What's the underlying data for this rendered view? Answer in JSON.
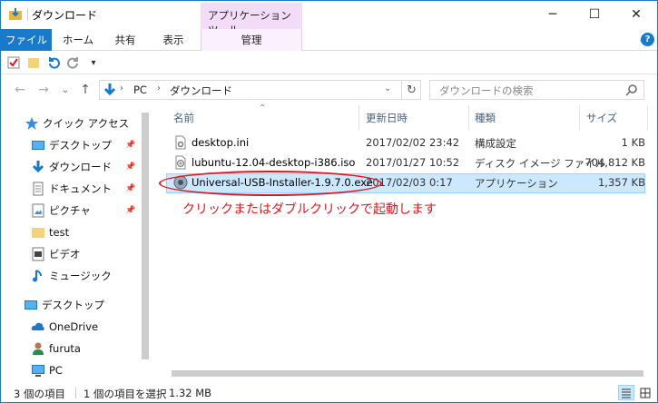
{
  "title": "ダウンロード",
  "tool_tab_header": "アプリケーション ツール",
  "window_buttons": {
    "minimize": "─",
    "maximize": "☐",
    "close": "✕"
  },
  "ribbon": {
    "tabs": [
      "ファイル",
      "ホーム",
      "共有",
      "表示",
      "管理"
    ],
    "expand": "⌄",
    "help": "?"
  },
  "qat": {
    "dropdown": "▾"
  },
  "address": {
    "back": "←",
    "forward": "→",
    "history": "⌄",
    "up": "↑",
    "crumbs": [
      "PC",
      "ダウンロード"
    ],
    "crumb_sep": "›",
    "dropdown": "⌄",
    "refresh": "↻"
  },
  "search": {
    "placeholder": "ダウンロードの検索"
  },
  "nav": {
    "quick_access": "クイック アクセス",
    "items": [
      {
        "label": "デスクトップ",
        "icon": "desktop-icon",
        "pinned": true
      },
      {
        "label": "ダウンロード",
        "icon": "download-icon",
        "pinned": true
      },
      {
        "label": "ドキュメント",
        "icon": "document-icon",
        "pinned": true
      },
      {
        "label": "ピクチャ",
        "icon": "picture-icon",
        "pinned": true
      },
      {
        "label": "test",
        "icon": "folder-icon",
        "pinned": false
      },
      {
        "label": "ビデオ",
        "icon": "video-icon",
        "pinned": false
      },
      {
        "label": "ミュージック",
        "icon": "music-icon",
        "pinned": false
      }
    ],
    "desktop": "デスクトップ",
    "onedrive": "OneDrive",
    "user": "furuta",
    "pc": "PC",
    "pin_glyph": "📌"
  },
  "columns": {
    "name": "名前",
    "date": "更新日時",
    "type": "種類",
    "size": "サイズ",
    "sort": "⌃"
  },
  "files": [
    {
      "name": "desktop.ini",
      "date": "2017/02/02 23:42",
      "type": "構成設定",
      "size": "1 KB",
      "selected": false,
      "icon": "settings-file-icon"
    },
    {
      "name": "lubuntu-12.04-desktop-i386.iso",
      "date": "2017/01/27 10:52",
      "type": "ディスク イメージ ファイル",
      "size": "704,812 KB",
      "selected": false,
      "icon": "disc-image-icon"
    },
    {
      "name": "Universal-USB-Installer-1.9.7.0.exe",
      "date": "2017/02/03 0:17",
      "type": "アプリケーション",
      "size": "1,357 KB",
      "selected": true,
      "icon": "usb-installer-icon"
    }
  ],
  "annotation": "クリックまたはダブルクリックで起動します",
  "status": {
    "count": "3 個の項目",
    "selected": "1 個の項目を選択",
    "selected_size": "1.32 MB"
  },
  "colors": {
    "accent": "#1979ca",
    "selection": "#cce8ff",
    "annotation": "#e0161e",
    "tool_tab": "#f3dcf8"
  }
}
